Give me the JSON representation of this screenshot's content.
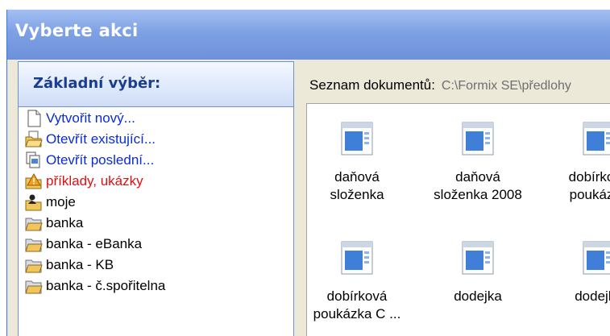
{
  "window": {
    "title": "Vyberte akci"
  },
  "left_panel": {
    "header": "Základní výběr:",
    "items": [
      {
        "label": "Vytvořit nový...",
        "icon": "new-document-icon",
        "color": "#0a2bd6"
      },
      {
        "label": "Otevřít existující...",
        "icon": "open-folder-icon",
        "color": "#0a2bd6"
      },
      {
        "label": "Otevřít poslední...",
        "icon": "recent-documents-icon",
        "color": "#0a2bd6"
      },
      {
        "label": "příklady, ukázky",
        "icon": "examples-folder-icon",
        "color": "#e01010"
      },
      {
        "label": "moje",
        "icon": "user-folder-icon",
        "color": "#000000"
      },
      {
        "label": "banka",
        "icon": "folder-icon",
        "color": "#000000"
      },
      {
        "label": "banka - eBanka",
        "icon": "folder-icon",
        "color": "#000000"
      },
      {
        "label": "banka - KB",
        "icon": "folder-icon",
        "color": "#000000"
      },
      {
        "label": "banka - č.spořitelna",
        "icon": "folder-icon",
        "color": "#000000"
      }
    ]
  },
  "right_panel": {
    "label": "Seznam dokumentů:",
    "path": "C:\\Formix SE\\předlohy",
    "documents": [
      {
        "line1": "daňová",
        "line2": "složenka"
      },
      {
        "line1": "daňová",
        "line2": "složenka 2008"
      },
      {
        "line1": "dobírková",
        "line2": "poukázka"
      },
      {
        "line1": "dobírková",
        "line2": "poukázka C ..."
      },
      {
        "line1": "dodejka",
        "line2": ""
      },
      {
        "line1": "dodejka",
        "line2": ""
      }
    ]
  }
}
